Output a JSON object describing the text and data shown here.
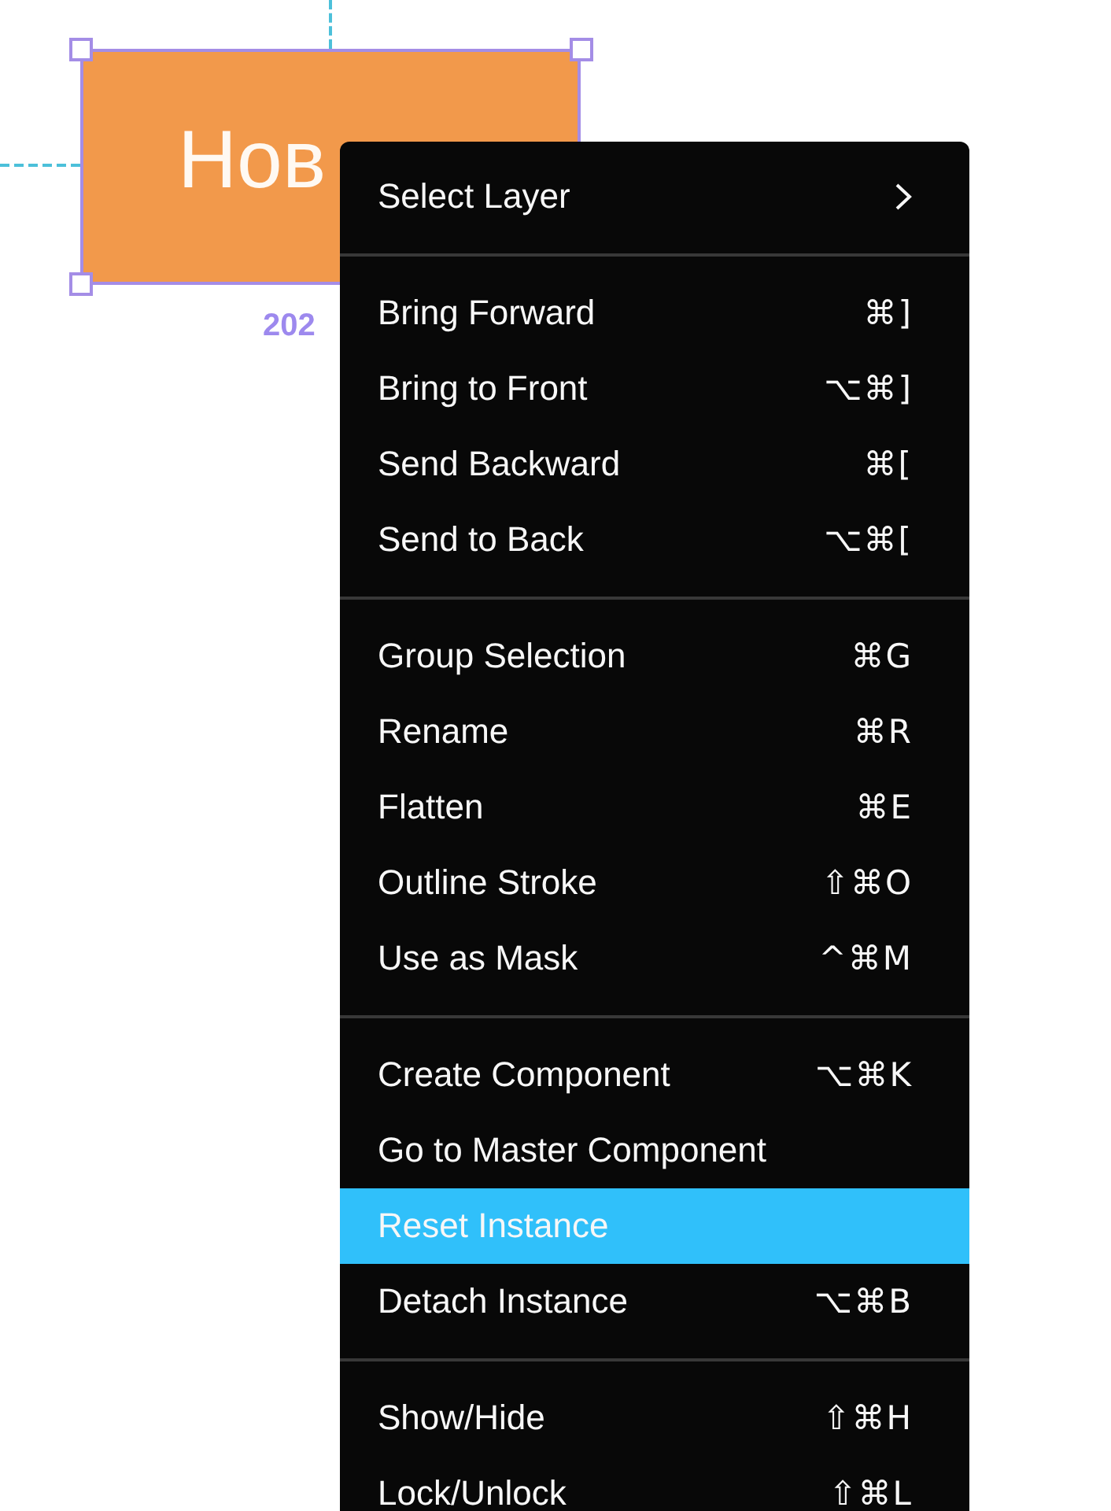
{
  "canvas": {
    "layer": {
      "text": "Нов",
      "selected": true,
      "size_label": "202"
    }
  },
  "context_menu": {
    "sections": [
      {
        "items": [
          {
            "label": "Select Layer",
            "submenu": true,
            "highlighted": false
          }
        ]
      },
      {
        "items": [
          {
            "label": "Bring Forward",
            "shortcut": "⌘]",
            "submenu": false,
            "highlighted": false
          },
          {
            "label": "Bring to Front",
            "shortcut": "⌥⌘]",
            "submenu": false,
            "highlighted": false
          },
          {
            "label": "Send Backward",
            "shortcut": "⌘[",
            "submenu": false,
            "highlighted": false
          },
          {
            "label": "Send to Back",
            "shortcut": "⌥⌘[",
            "submenu": false,
            "highlighted": false
          }
        ]
      },
      {
        "items": [
          {
            "label": "Group Selection",
            "shortcut": "⌘G",
            "submenu": false,
            "highlighted": false
          },
          {
            "label": "Rename",
            "shortcut": "⌘R",
            "submenu": false,
            "highlighted": false
          },
          {
            "label": "Flatten",
            "shortcut": "⌘E",
            "submenu": false,
            "highlighted": false
          },
          {
            "label": "Outline Stroke",
            "shortcut": "⇧⌘O",
            "submenu": false,
            "highlighted": false
          },
          {
            "label": "Use as Mask",
            "shortcut": "^⌘M",
            "submenu": false,
            "highlighted": false
          }
        ]
      },
      {
        "items": [
          {
            "label": "Create Component",
            "shortcut": "⌥⌘K",
            "submenu": false,
            "highlighted": false
          },
          {
            "label": "Go to Master Component",
            "submenu": false,
            "highlighted": false
          },
          {
            "label": "Reset Instance",
            "submenu": false,
            "highlighted": true
          },
          {
            "label": "Detach Instance",
            "shortcut": "⌥⌘B",
            "submenu": false,
            "highlighted": false
          }
        ]
      },
      {
        "items": [
          {
            "label": "Show/Hide",
            "shortcut": "⇧⌘H",
            "submenu": false,
            "highlighted": false
          },
          {
            "label": "Lock/Unlock",
            "shortcut": "⇧⌘L",
            "submenu": false,
            "highlighted": false
          }
        ]
      }
    ]
  }
}
